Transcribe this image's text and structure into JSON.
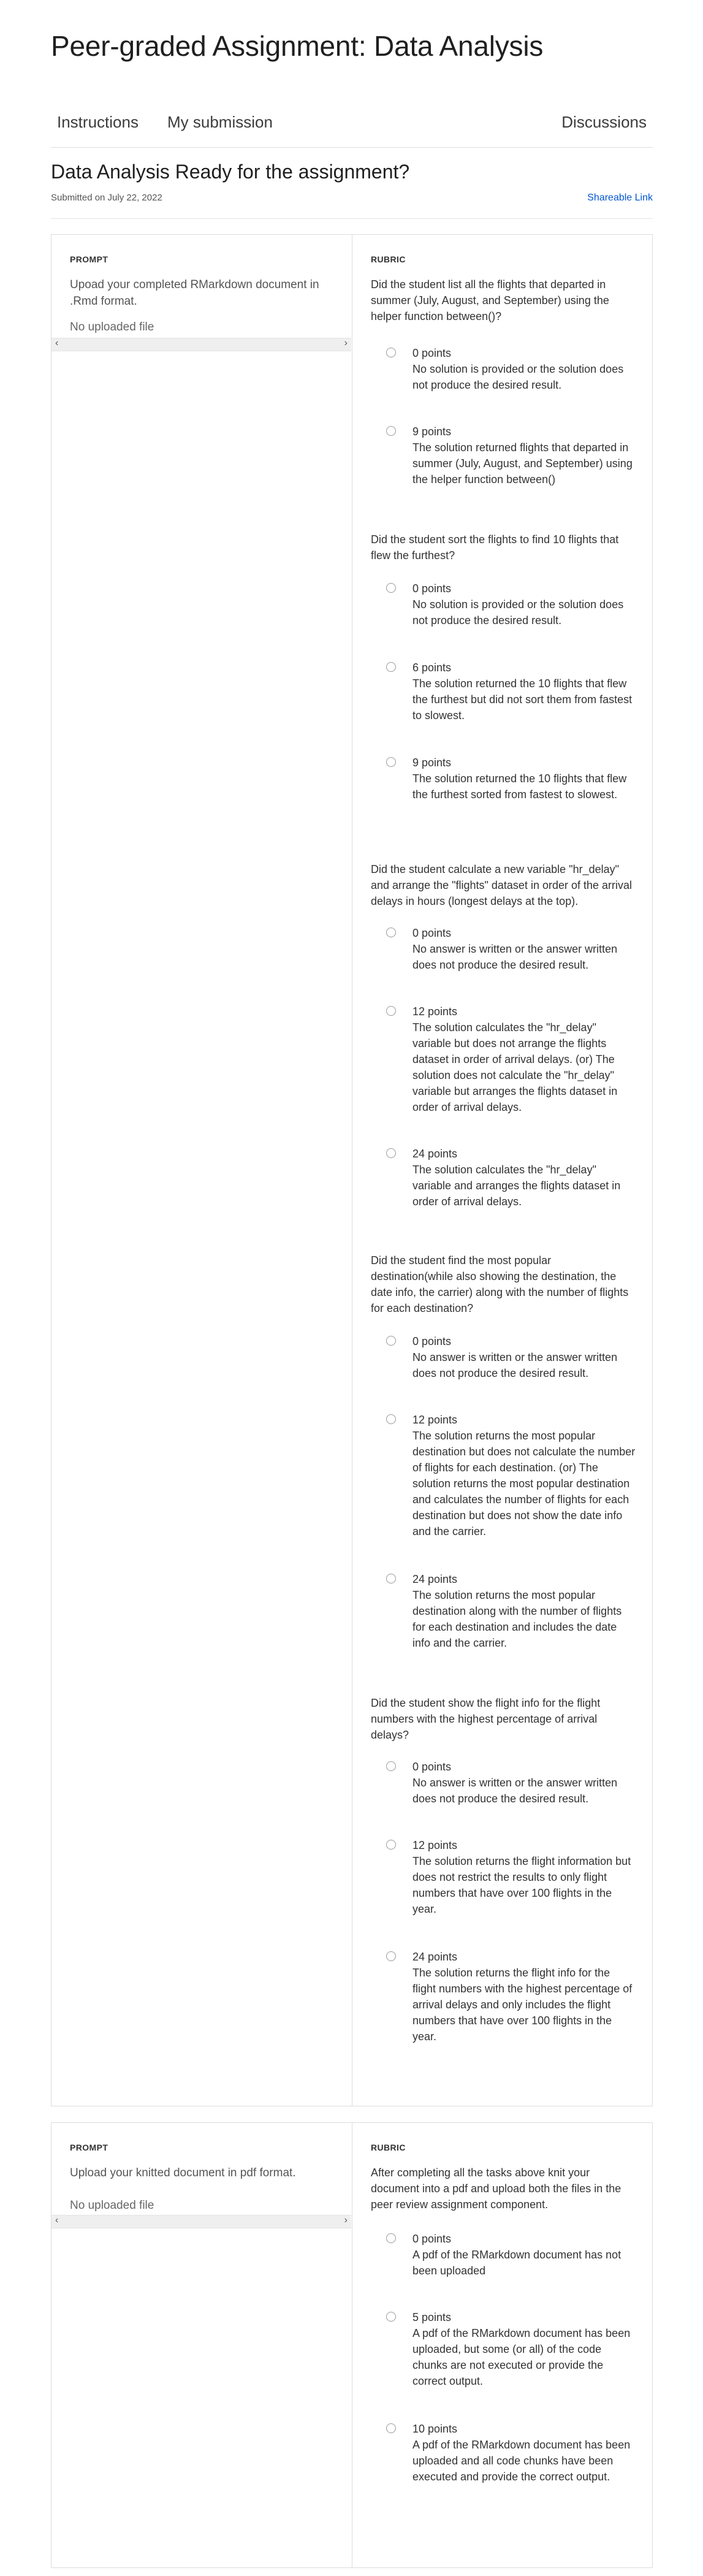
{
  "page_title": "Peer-graded Assignment: Data Analysis",
  "tabs": {
    "instructions": "Instructions",
    "my_submission": "My submission",
    "discussions": "Discussions"
  },
  "submission": {
    "title": "Data Analysis Ready for the assignment?",
    "submitted": "Submitted on July 22, 2022",
    "share_link": "Shareable Link"
  },
  "labels": {
    "prompt": "PROMPT",
    "rubric": "RUBRIC"
  },
  "card1": {
    "prompt_text": "Upoad your completed RMarkdown document in .Rmd format.",
    "no_file": "No uploaded file",
    "questions": [
      {
        "text": "Did the student list all the flights that departed in summer (July, August, and September) using the helper function between()?",
        "options": [
          {
            "points": "0 points",
            "desc": "No solution is provided or the solution does not produce the desired result."
          },
          {
            "points": "9 points",
            "desc": "The solution returned flights that departed in summer (July, August, and September) using the helper function between()"
          }
        ]
      },
      {
        "text": "Did the student sort the flights to find 10 flights that flew the furthest?",
        "options": [
          {
            "points": "0 points",
            "desc": "No solution is provided or the solution does not produce the desired result."
          },
          {
            "points": "6 points",
            "desc": "The solution returned the 10 flights that flew the furthest but did not sort them from fastest to slowest."
          },
          {
            "points": "9 points",
            "desc": "The solution returned the 10 flights that flew the furthest sorted from fastest to slowest."
          }
        ]
      },
      {
        "text": "Did the student calculate a new variable \"hr_delay\" and arrange the \"flights\" dataset in order of the arrival delays in hours (longest delays at the top).",
        "options": [
          {
            "points": "0 points",
            "desc": "No answer is written or the answer written does not produce the desired result."
          },
          {
            "points": "12 points",
            "desc": "The solution calculates the \"hr_delay\" variable but does not arrange the flights dataset in order of arrival delays. (or) The solution does not calculate the \"hr_delay\" variable but arranges the flights dataset in order of arrival delays."
          },
          {
            "points": "24 points",
            "desc": "The solution calculates the \"hr_delay\" variable and arranges the flights dataset in order of arrival delays."
          }
        ]
      },
      {
        "text": "Did the student find the most popular destination(while also showing the destination, the date info, the carrier) along with the number of flights for each destination?",
        "options": [
          {
            "points": "0 points",
            "desc": "No answer is written or the answer written does not produce the desired result."
          },
          {
            "points": "12 points",
            "desc": "The solution returns the most popular destination but does not calculate the number of flights for each destination. (or) The solution returns the most popular destination and calculates the number of flights for each destination but does not show the date info and the carrier."
          },
          {
            "points": "24 points",
            "desc": "The solution returns the most popular destination along with the number of flights for each destination and includes the date info and the carrier."
          }
        ]
      },
      {
        "text": "Did the student show the flight info for the flight numbers with the highest percentage of arrival delays?",
        "options": [
          {
            "points": "0 points",
            "desc": "No answer is written or the answer written does not produce the desired result."
          },
          {
            "points": "12 points",
            "desc": "The solution returns the flight information but does not restrict the results to only flight numbers that have over 100 flights in the year."
          },
          {
            "points": "24 points",
            "desc": "The solution returns the flight info for the flight numbers with the highest percentage of arrival delays and only includes the flight numbers that have over 100 flights in the year."
          }
        ]
      }
    ]
  },
  "card2": {
    "prompt_text": "Upload your knitted document in pdf format.",
    "no_file": "No uploaded file",
    "question": "After completing all the tasks above knit your document into a pdf and upload both the files in the peer review assignment component.",
    "options": [
      {
        "points": "0 points",
        "desc": "A pdf of the RMarkdown document has not been uploaded"
      },
      {
        "points": "5 points",
        "desc": "A pdf of the RMarkdown document has been uploaded, but some (or all) of the code chunks are not executed or provide the correct output."
      },
      {
        "points": "10 points",
        "desc": "A pdf of the RMarkdown document has been uploaded and all code chunks have been executed and provide the correct output."
      }
    ]
  }
}
